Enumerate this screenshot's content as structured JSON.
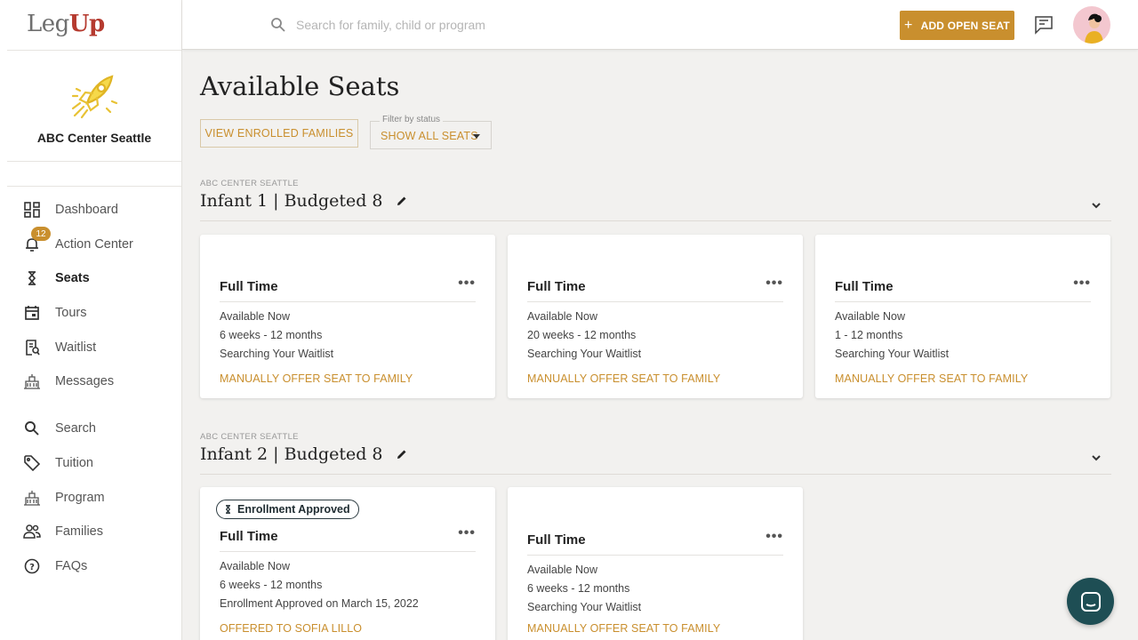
{
  "brand": {
    "logo_leg": "Leg",
    "logo_up": "Up",
    "accent": "#c98f2e"
  },
  "center": {
    "name": "ABC Center Seattle"
  },
  "sidebar": {
    "items": [
      {
        "label": "Dashboard",
        "icon": "dashboard-icon"
      },
      {
        "label": "Action Center",
        "icon": "bell-icon",
        "badge": "12"
      },
      {
        "label": "Seats",
        "icon": "seat-icon",
        "active": true
      },
      {
        "label": "Tours",
        "icon": "calendar-icon"
      },
      {
        "label": "Waitlist",
        "icon": "waitlist-icon"
      },
      {
        "label": "Messages",
        "icon": "building-icon"
      },
      {
        "label": "Search",
        "icon": "search-icon"
      },
      {
        "label": "Tuition",
        "icon": "tag-icon"
      },
      {
        "label": "Program",
        "icon": "building-icon"
      },
      {
        "label": "Families",
        "icon": "people-icon"
      },
      {
        "label": "FAQs",
        "icon": "help-icon"
      }
    ]
  },
  "topbar": {
    "search_placeholder": "Search for family, child or program",
    "add_seat_label": "ADD OPEN SEAT"
  },
  "main": {
    "title": "Available Seats",
    "view_enrolled_label": "VIEW ENROLLED FAMILIES",
    "filter_label": "Filter by status",
    "filter_value": "SHOW ALL SEATS"
  },
  "sections": [
    {
      "subtitle": "ABC CENTER SEATTLE",
      "title": "Infant 1 | Budgeted 8",
      "cards": [
        {
          "title": "Full Time",
          "lines": [
            "Available Now",
            "6 weeks - 12 months",
            "Searching Your Waitlist"
          ],
          "link": "MANUALLY OFFER SEAT TO FAMILY"
        },
        {
          "title": "Full Time",
          "lines": [
            "Available Now",
            "20 weeks - 12 months",
            "Searching Your Waitlist"
          ],
          "link": "MANUALLY OFFER SEAT TO FAMILY"
        },
        {
          "title": "Full Time",
          "lines": [
            "Available Now",
            "1 - 12 months",
            "Searching Your Waitlist"
          ],
          "link": "MANUALLY OFFER SEAT TO FAMILY"
        }
      ]
    },
    {
      "subtitle": "ABC CENTER SEATTLE",
      "title": "Infant 2 | Budgeted 8",
      "cards": [
        {
          "status": "Enrollment Approved",
          "title": "Full Time",
          "lines": [
            "Available Now",
            "6 weeks - 12 months",
            "Enrollment Approved on March 15, 2022"
          ],
          "link": "OFFERED TO SOFIA LILLO"
        },
        {
          "title": "Full Time",
          "lines": [
            "Available Now",
            "6 weeks - 12 months",
            "Searching Your Waitlist"
          ],
          "link": "MANUALLY OFFER SEAT TO FAMILY"
        }
      ]
    }
  ]
}
